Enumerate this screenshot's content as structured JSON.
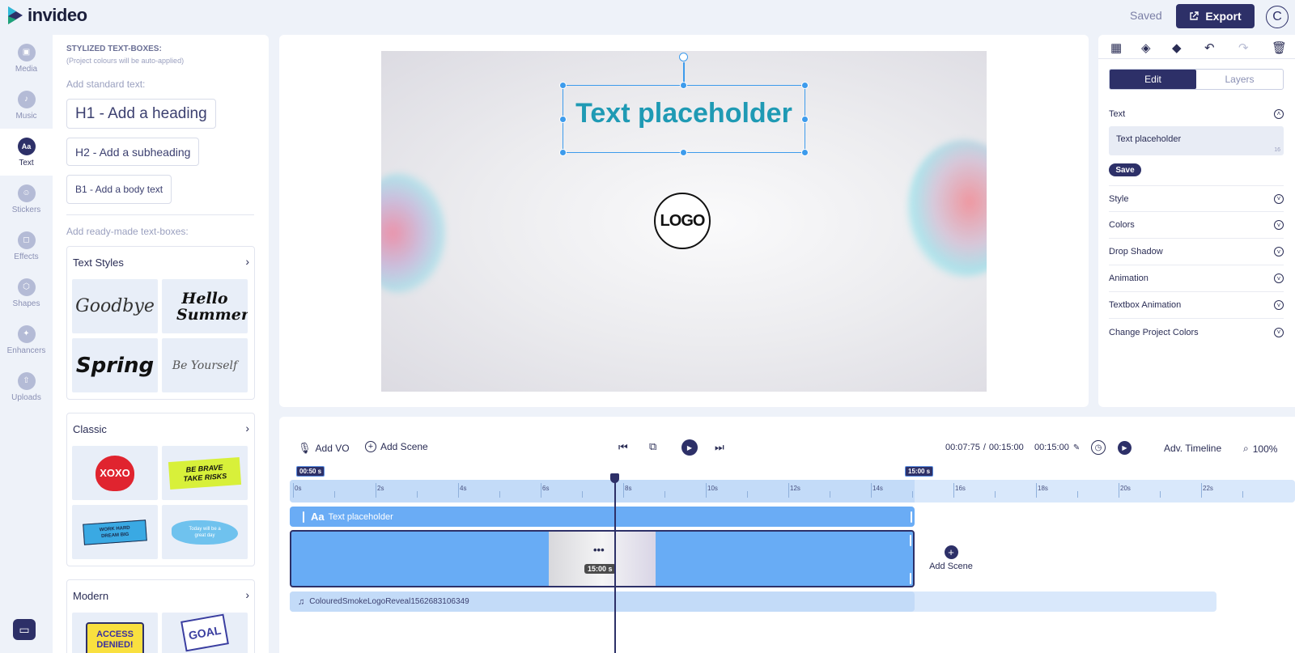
{
  "app": {
    "name": "invideo",
    "saved_label": "Saved",
    "export_label": "Export",
    "avatar_letter": "C"
  },
  "rail": [
    {
      "label": "Media",
      "icon": "image-icon"
    },
    {
      "label": "Music",
      "icon": "music-icon"
    },
    {
      "label": "Text",
      "icon": "text-icon",
      "icon_text": "Aa",
      "active": true
    },
    {
      "label": "Stickers",
      "icon": "sticker-icon"
    },
    {
      "label": "Effects",
      "icon": "effects-icon"
    },
    {
      "label": "Shapes",
      "icon": "shapes-icon"
    },
    {
      "label": "Enhancers",
      "icon": "enhancers-icon"
    },
    {
      "label": "Uploads",
      "icon": "upload-icon"
    }
  ],
  "text_panel": {
    "heading": "STYLIZED TEXT-BOXES:",
    "subheading": "(Project colours will be auto-applied)",
    "standard_label": "Add standard text:",
    "h1": "H1 - Add a heading",
    "h2": "H2 - Add a subheading",
    "b1": "B1 - Add a body text",
    "readymade_label": "Add ready-made text-boxes:",
    "sections": [
      {
        "title": "Text Styles",
        "items": [
          "Goodbye",
          "Hello Summer",
          "Spring",
          "Be Yourself"
        ]
      },
      {
        "title": "Classic",
        "items": [
          "XOXO",
          "BE BRAVE TAKE RISKS",
          "WORK HARD DREAM BIG",
          "Today will be a great day"
        ]
      },
      {
        "title": "Modern",
        "items": [
          "ACCESS DENIED!",
          "GOAL"
        ]
      }
    ]
  },
  "canvas": {
    "text": "Text placeholder",
    "logo": "LOGO",
    "text_color": "#1f9ab4"
  },
  "right_panel": {
    "tab_edit": "Edit",
    "tab_layers": "Layers",
    "text_section": "Text",
    "text_value": "Text placeholder",
    "char_count": "16",
    "save_label": "Save",
    "sections": [
      "Style",
      "Colors",
      "Drop Shadow",
      "Animation",
      "Textbox Animation",
      "Change Project Colors"
    ]
  },
  "timeline": {
    "add_vo": "Add VO",
    "add_scene": "Add Scene",
    "time_current": "00:07:75",
    "time_separator": "/",
    "time_total": "00:15:00",
    "duration": "00:15:00",
    "adv_timeline": "Adv. Timeline",
    "zoom": "100%",
    "marker_start": "00:50 s",
    "marker_end": "15:00 s",
    "ticks": [
      "0s",
      "2s",
      "4s",
      "6s",
      "8s",
      "10s",
      "12s",
      "14s",
      "16s",
      "18s",
      "20s",
      "22s"
    ],
    "text_track_label": "Text placeholder",
    "text_track_icon": "Aa",
    "scene_duration": "15:00 s",
    "scene_menu": "•••",
    "audio_track_label": "ColouredSmokeLogoReveal1562683106349",
    "add_scene_side": "Add Scene"
  },
  "colors": {
    "primary": "#2d3068",
    "accent": "#3d9bec",
    "track": "#6aacf5"
  }
}
